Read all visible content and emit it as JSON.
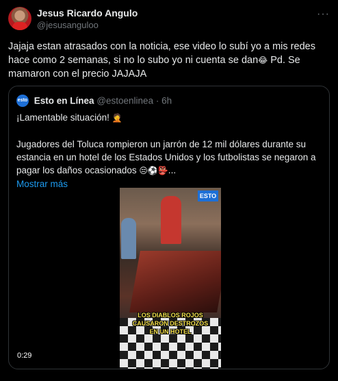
{
  "author": {
    "display_name": "Jesus Ricardo Angulo",
    "handle": "@jesusanguloo"
  },
  "more_icon": "more-horizontal-icon",
  "tweet": {
    "line1": "Jajaja estan atrasados con la noticia, ese video lo subí yo a mis redes",
    "line2": "hace como 2 semanas, si no lo subo yo ni cuenta se dan",
    "emoji1": "😂",
    "line2_end": " Pd. Se",
    "line3": "mamaron con el precio JAJAJA"
  },
  "quote": {
    "logo_text": "esto",
    "name": "Esto en Línea",
    "handle_time": "@estoenlinea · 6h",
    "p1": "¡Lamentable situación!",
    "p1_emoji": "🤦",
    "p2": "Jugadores del Toluca rompieron un jarrón de 12 mil dólares durante su estancia en un hotel de los Estados Unidos y los futbolistas se negaron a pagar los daños ocasionados",
    "p2_emoji": "😒⚽👺...",
    "more_label": "Mostrar más",
    "video": {
      "logo_tag": "ESTO",
      "caption": "LOS DIABLOS ROJOS CAUSARON DESTROZOS EN UN HOTEL",
      "duration": "0:29"
    }
  }
}
